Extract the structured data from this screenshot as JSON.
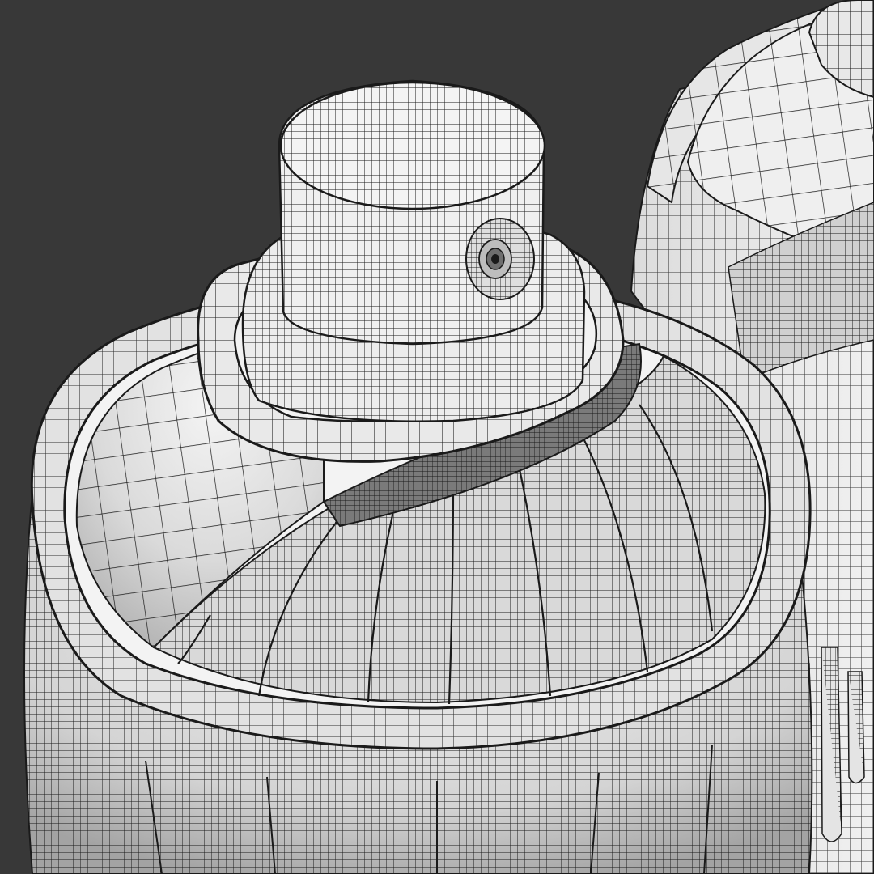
{
  "scene": {
    "subject": "wireframe-render-spray-cans",
    "colors": {
      "background": "#383838",
      "surface_light": "#ececec",
      "surface_mid": "#d6d6d6",
      "surface_shadow": "#a9a9a9",
      "wire": "#1a1a1a"
    },
    "objects": [
      {
        "name": "front-spray-can",
        "parts": [
          "nozzle-cap",
          "actuator-base",
          "cap-collar",
          "valve-cup",
          "dome-shoulder",
          "rim-bead",
          "body"
        ]
      },
      {
        "name": "rear-spray-can",
        "parts": [
          "top-ring",
          "dome-shoulder",
          "rim-bead",
          "body",
          "paint-drips"
        ]
      }
    ]
  }
}
